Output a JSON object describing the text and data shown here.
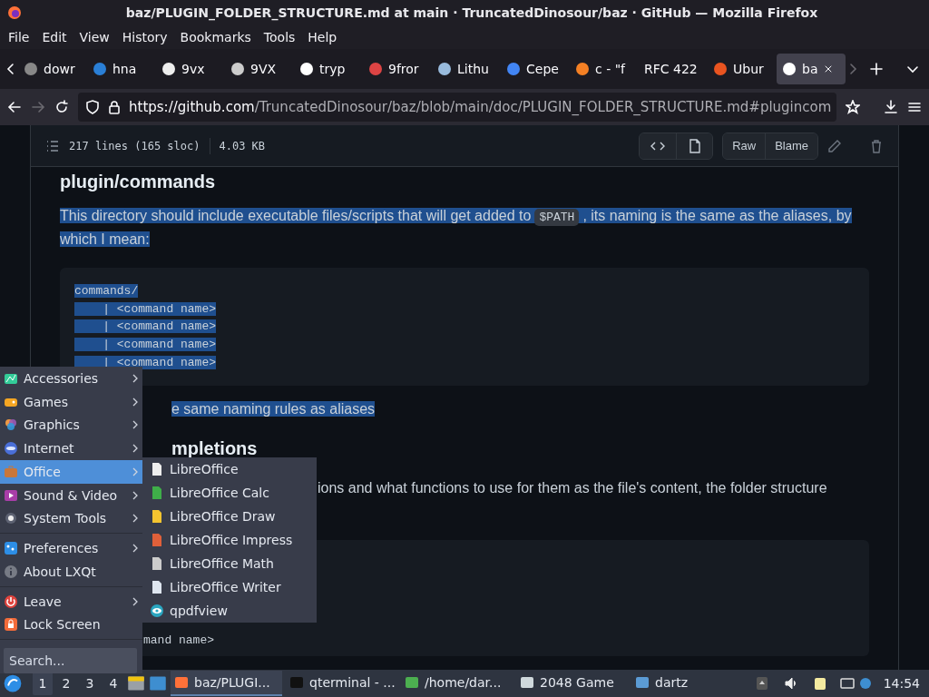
{
  "window": {
    "title": "baz/PLUGIN_FOLDER_STRUCTURE.md at main · TruncatedDinosour/baz · GitHub — Mozilla Firefox"
  },
  "menu_bar": [
    "File",
    "Edit",
    "View",
    "History",
    "Bookmarks",
    "Tools",
    "Help"
  ],
  "tabs": [
    {
      "label": "dowr",
      "selected": false
    },
    {
      "label": "hna",
      "selected": false
    },
    {
      "label": "9vx",
      "selected": false
    },
    {
      "label": "9VX",
      "selected": false
    },
    {
      "label": "tryp",
      "selected": false
    },
    {
      "label": "9fror",
      "selected": false
    },
    {
      "label": "Lithu",
      "selected": false
    },
    {
      "label": "Cepe",
      "selected": false
    },
    {
      "label": "c - \"f",
      "selected": false
    },
    {
      "label": "RFC 422",
      "selected": false
    },
    {
      "label": "Ubur",
      "selected": false
    },
    {
      "label": "ba",
      "selected": true
    }
  ],
  "nav": {
    "forward_disabled": true,
    "url_host": "https://github.com",
    "url_rest": "/TruncatedDinosour/baz/blob/main/doc/PLUGIN_FOLDER_STRUCTURE.md#plugincom"
  },
  "file_header": {
    "lines": "217 lines (165 sloc)",
    "size": "4.03 KB",
    "buttons": [
      "Raw",
      "Blame"
    ]
  },
  "document": {
    "heading": "plugin/commands",
    "paragraph": {
      "highlighted": true,
      "before": "This directory should include executable files/scripts that will get added to",
      "code": "$PATH",
      "after": ", its naming is the same as the aliases, by which I mean:"
    },
    "code_block": {
      "highlighted": true,
      "lines": [
        "commands/",
        "    | <command name>",
        "    | <command name>",
        "    | <command name>",
        "    | <command name>"
      ]
    },
    "note": {
      "highlighted": true,
      "text": "e same naming rules as aliases"
    },
    "heading_2": "mpletions",
    "paragraph_2": "ions and what functions to use for them as the file's content, the folder structure",
    "code_block_2": {
      "lines": [
        "mand name>"
      ]
    }
  },
  "app_menu": {
    "groups": [
      [
        {
          "label": "Accessories",
          "has_submenu": true,
          "selected": false
        },
        {
          "label": "Games",
          "has_submenu": true,
          "selected": false
        },
        {
          "label": "Graphics",
          "has_submenu": true,
          "selected": false
        },
        {
          "label": "Internet",
          "has_submenu": true,
          "selected": false
        },
        {
          "label": "Office",
          "has_submenu": true,
          "selected": true
        },
        {
          "label": "Sound & Video",
          "has_submenu": true,
          "selected": false
        },
        {
          "label": "System Tools",
          "has_submenu": true,
          "selected": false
        }
      ],
      [
        {
          "label": "Preferences",
          "has_submenu": true,
          "selected": false
        },
        {
          "label": "About LXQt",
          "has_submenu": false,
          "selected": false
        }
      ],
      [
        {
          "label": "Leave",
          "has_submenu": true,
          "selected": false
        },
        {
          "label": "Lock Screen",
          "has_submenu": false,
          "selected": false
        }
      ]
    ],
    "search": {
      "placeholder": "Search..."
    }
  },
  "submenu": [
    {
      "label": "LibreOffice"
    },
    {
      "label": "LibreOffice Calc"
    },
    {
      "label": "LibreOffice Draw"
    },
    {
      "label": "LibreOffice Impress"
    },
    {
      "label": "LibreOffice Math"
    },
    {
      "label": "LibreOffice Writer"
    },
    {
      "label": "qpdfview"
    }
  ],
  "taskbar": {
    "desktops": [
      {
        "label": "1",
        "selected": true
      },
      {
        "label": "2",
        "selected": false
      },
      {
        "label": "3",
        "selected": false
      },
      {
        "label": "4",
        "selected": false
      }
    ],
    "tasks": [
      {
        "label": "baz/PLUGI...",
        "selected": true
      },
      {
        "label": "qterminal - ...",
        "selected": false
      },
      {
        "label": "/home/dar...",
        "selected": false
      },
      {
        "label": "2048 Game",
        "selected": false
      },
      {
        "label": "dartz",
        "selected": false
      }
    ],
    "clock": "14:54"
  }
}
